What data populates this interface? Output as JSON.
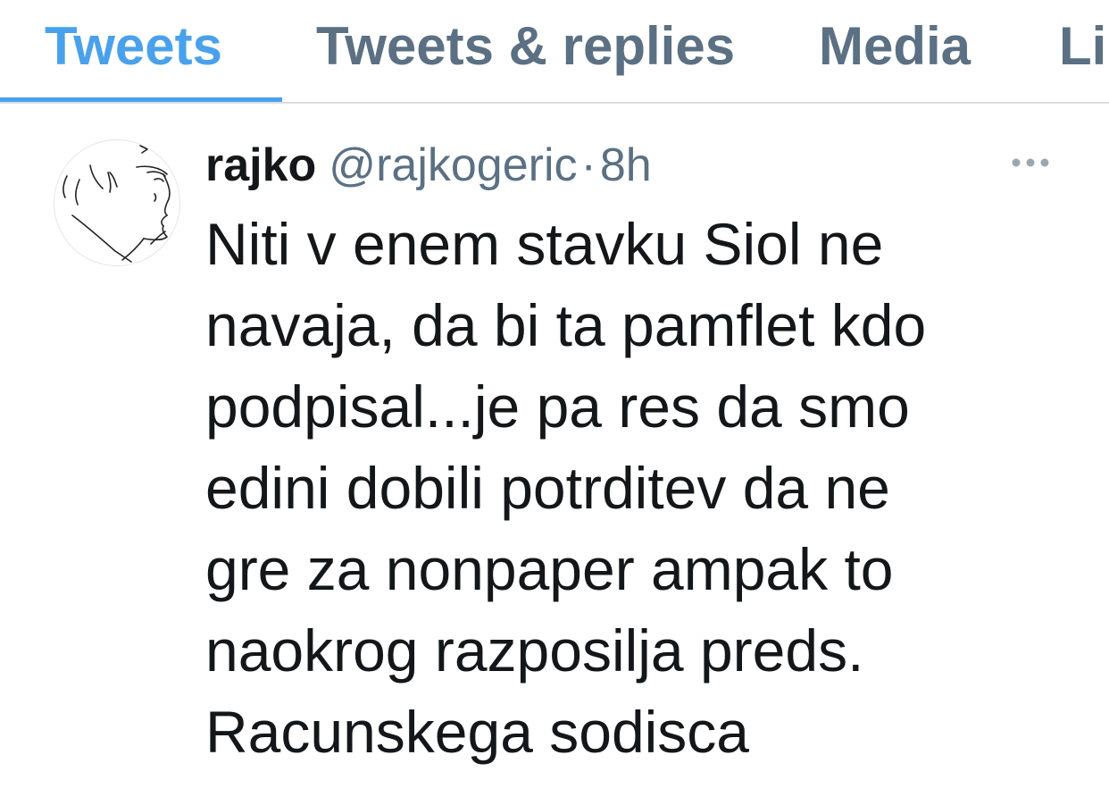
{
  "tabs": [
    {
      "label": "Tweets",
      "active": true
    },
    {
      "label": "Tweets & replies",
      "active": false
    },
    {
      "label": "Media",
      "active": false
    },
    {
      "label": "Li",
      "active": false
    }
  ],
  "tweet": {
    "display_name": "rajko",
    "handle": "@rajkogeric",
    "separator": "·",
    "timestamp": "8h",
    "more_icon": "more-horizontal-icon",
    "text": "Niti v enem stavku Siol ne\nnavaja, da bi ta pamflet kdo\npodpisal...je pa res da smo\nedini dobili potrditev da ne\ngre za nonpaper ampak to\nnaokrog razposilja preds.\nRacunskega sodisca"
  },
  "colors": {
    "accent": "#4aa1eb",
    "secondary_text": "#5b7083",
    "primary_text": "#14171a",
    "divider": "#d9dfe4"
  }
}
